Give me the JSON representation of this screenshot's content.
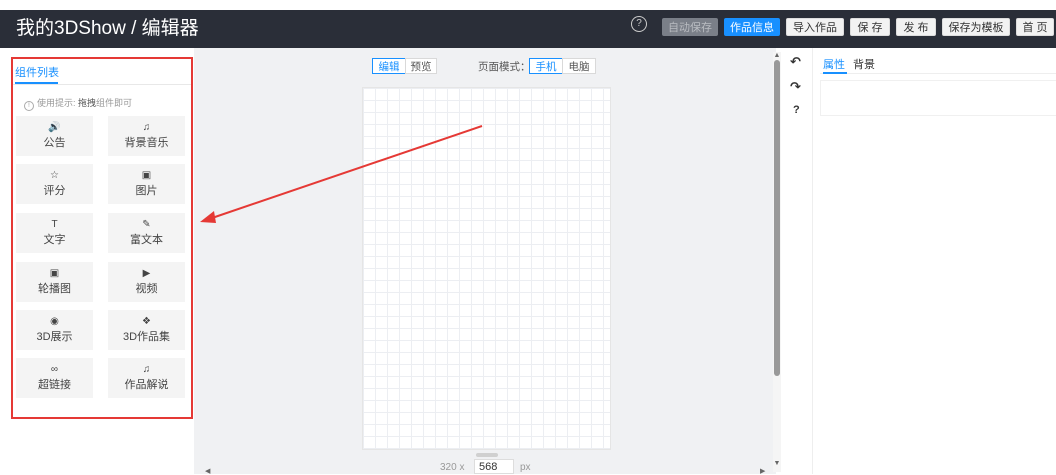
{
  "app": {
    "title": "我的3DShow / 编辑器"
  },
  "topbar": {
    "help_icon": "question-circle-icon",
    "buttons": [
      {
        "label": "自动保存",
        "state": "disabled"
      },
      {
        "label": "作品信息",
        "state": "primary"
      },
      {
        "label": "导入作品",
        "state": "normal"
      },
      {
        "label": "保 存",
        "state": "normal"
      },
      {
        "label": "发 布",
        "state": "normal"
      },
      {
        "label": "保存为模板",
        "state": "normal"
      },
      {
        "label": "首 页",
        "state": "normal"
      }
    ]
  },
  "left_panel": {
    "tab": "组件列表",
    "tip_prefix": "使用提示:",
    "tip_bold": "拖拽",
    "tip_suffix": "组件即可",
    "components": [
      {
        "label": "公告",
        "icon": "🔊",
        "icon_name": "speaker-icon"
      },
      {
        "label": "背景音乐",
        "icon": "♫",
        "icon_name": "music-note-icon"
      },
      {
        "label": "评分",
        "icon": "☆",
        "icon_name": "star-icon"
      },
      {
        "label": "图片",
        "icon": "▣",
        "icon_name": "image-icon"
      },
      {
        "label": "文字",
        "icon": "T",
        "icon_name": "text-icon"
      },
      {
        "label": "富文本",
        "icon": "✎",
        "icon_name": "edit-icon"
      },
      {
        "label": "轮播图",
        "icon": "▣",
        "icon_name": "carousel-image-icon"
      },
      {
        "label": "视频",
        "icon": "▶",
        "icon_name": "video-icon"
      },
      {
        "label": "3D展示",
        "icon": "◉",
        "icon_name": "cube-icon"
      },
      {
        "label": "3D作品集",
        "icon": "❖",
        "icon_name": "cubes-icon"
      },
      {
        "label": "超链接",
        "icon": "∞",
        "icon_name": "link-icon"
      },
      {
        "label": "作品解说",
        "icon": "♫",
        "icon_name": "music-note-icon"
      }
    ]
  },
  "editor": {
    "edit_label": "编辑",
    "preview_label": "预览",
    "page_mode_label": "页面模式：",
    "mobile_label": "手机",
    "desktop_label": "电脑",
    "width": "320 x",
    "height": "568",
    "unit": "px"
  },
  "toolbar": {
    "undo_icon": "undo-icon",
    "redo_icon": "redo-icon",
    "help_label": "?"
  },
  "right_panel": {
    "tabs": [
      "属性",
      "背景"
    ]
  },
  "annotation": {
    "color": "#e53935"
  }
}
